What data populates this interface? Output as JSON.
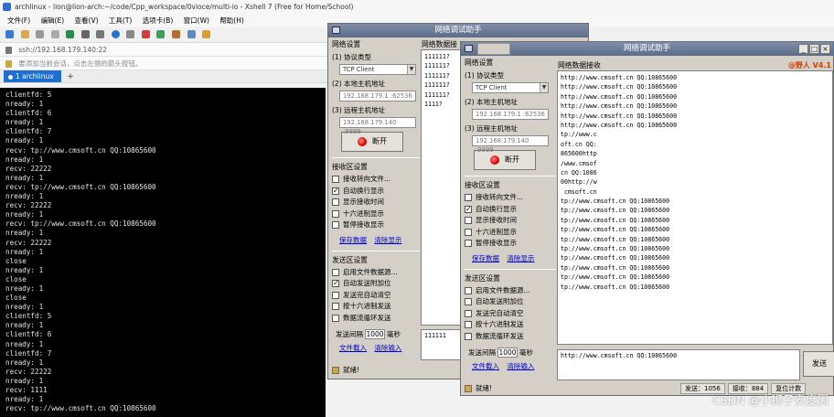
{
  "xshell": {
    "title": "archlinux - lion@lion-arch:~/code/Cpp_workspace/0vioce/multi-io - Xshell 7 (Free for Home/School)",
    "menu": [
      "文件(F)",
      "编辑(E)",
      "查看(V)",
      "工具(T)",
      "选项卡(B)",
      "窗口(W)",
      "帮助(H)"
    ],
    "address": "ssh://192.168.179.140:22",
    "hint": "要添加当前会话，点击左侧的箭头按钮。",
    "tab_label": "1 archlinux",
    "tab_add": "+",
    "terminal_lines": [
      "clientfd: 5",
      "nready: 1",
      "clientfd: 6",
      "nready: 1",
      "clientfd: 7",
      "nready: 1",
      "recv: tp://www.cmsoft.cn QQ:10865600",
      "nready: 1",
      "recv: 22222",
      "nready: 1",
      "recv: tp://www.cmsoft.cn QQ:10865600",
      "nready: 1",
      "recv: 22222",
      "nready: 1",
      "recv: tp://www.cmsoft.cn QQ:10865600",
      "nready: 1",
      "recv: 22222",
      "nready: 1",
      "close",
      "nready: 1",
      "close",
      "nready: 1",
      "close",
      "nready: 1",
      "clientfd: 5",
      "nready: 1",
      "clientfd: 6",
      "nready: 1",
      "clientfd: 7",
      "nready: 1",
      "recv: 22222",
      "nready: 1",
      "recv: 1111",
      "nready: 1",
      "recv: tp://www.cmsoft.cn QQ:10865600"
    ]
  },
  "assistant_back": {
    "title": "网络调试助手",
    "net_settings": "网络设置",
    "protocol_label": "(1) 协议类型",
    "protocol_value": "TCP Client",
    "local_label": "(2) 本地主机地址",
    "local_value": "192.168.179.1 :62536",
    "remote_label": "(3) 远程主机地址",
    "remote_value": "192.168.179.140 :9999",
    "disconnect": "断开",
    "recv_settings": "接收区设置",
    "recv_opts": [
      {
        "label": "接收转向文件...",
        "checked": false
      },
      {
        "label": "自动换行显示",
        "checked": true
      },
      {
        "label": "显示接收时间",
        "checked": false
      },
      {
        "label": "十六进制显示",
        "checked": false
      },
      {
        "label": "暂停接收显示",
        "checked": false
      }
    ],
    "save_data": "保存数据",
    "clear_display": "清除显示",
    "send_settings": "发送区设置",
    "send_opts": [
      {
        "label": "启用文件数据源...",
        "checked": false
      },
      {
        "label": "自动发送附加位",
        "checked": true
      },
      {
        "label": "发送完自动清空",
        "checked": false
      },
      {
        "label": "按十六进制发送",
        "checked": false
      },
      {
        "label": "数据流循环发送",
        "checked": false
      }
    ],
    "period_label": "发送间隔",
    "period_value": "1000",
    "period_unit": "毫秒",
    "load_file": "文件载入",
    "clear_input": "清除输入",
    "recv_header": "网络数据接",
    "recv_lines": [
      "111111?",
      "111111?",
      "111111?",
      "111111?",
      "111111?",
      "1111?"
    ],
    "send_text": "111111",
    "status": "就绪!"
  },
  "assistant_front": {
    "title": "网络调试助手",
    "brand": "@野人 V4.1",
    "net_settings": "网络设置",
    "protocol_label": "(1) 协议类型",
    "protocol_value": "TCP Client",
    "local_label": "(2) 本地主机地址",
    "local_value": "192.168.179.1 :62536",
    "remote_label": "(3) 远程主机地址",
    "remote_value": "192.168.179.140 :9999",
    "disconnect": "断开",
    "recv_settings": "接收区设置",
    "recv_opts": [
      {
        "label": "接收转向文件...",
        "checked": false
      },
      {
        "label": "自动换行显示",
        "checked": true
      },
      {
        "label": "显示接收时间",
        "checked": false
      },
      {
        "label": "十六进制显示",
        "checked": false
      },
      {
        "label": "暂停接收显示",
        "checked": false
      }
    ],
    "save_data": "保存数据",
    "clear_display": "清除显示",
    "send_settings": "发送区设置",
    "send_opts": [
      {
        "label": "启用文件数据源...",
        "checked": false
      },
      {
        "label": "自动发送附加位",
        "checked": false
      },
      {
        "label": "发送完自动清空",
        "checked": false
      },
      {
        "label": "按十六进制发送",
        "checked": false
      },
      {
        "label": "数据流循环发送",
        "checked": false
      }
    ],
    "period_label": "发送间隔",
    "period_value": "1000",
    "period_unit": "毫秒",
    "load_file": "文件载入",
    "clear_input": "清除输入",
    "recv_header": "网络数据接收",
    "recv_lines": [
      "http://www.cmsoft.cn QQ:10865600",
      "http://www.cmsoft.cn QQ:10865600",
      "http://www.cmsoft.cn QQ:10865600",
      "http://www.cmsoft.cn QQ:10865600",
      "http://www.cmsoft.cn QQ:10865600",
      "http://www.cmsoft.cn QQ:10865600",
      "tp://www.c",
      "oft.cn QQ:",
      "865600http",
      "/www.cmsof",
      "cn QQ:1086",
      "00http://w",
      " cmsoft.cn",
      "tp://www.cmsoft.cn QQ:10865600",
      "tp://www.cmsoft.cn QQ:10865600",
      "tp://www.cmsoft.cn QQ:10865600",
      "tp://www.cmsoft.cn QQ:10865600",
      "tp://www.cmsoft.cn QQ:10865600",
      "tp://www.cmsoft.cn QQ:10865600",
      "tp://www.cmsoft.cn QQ:10865600",
      "tp://www.cmsoft.cn QQ:10865600",
      "tp://www.cmsoft.cn QQ:10865600",
      "tp://www.cmsoft.cn QQ:10865600"
    ],
    "send_text": "http://www.cmsoft.cn QQ:10865600",
    "send_button": "发送",
    "status": "就绪!",
    "sent_label": "发送：1056",
    "recv_count_label": "接收：884",
    "reset_label": "复位计数"
  },
  "watermark": "CSDN @小狮子安度因"
}
